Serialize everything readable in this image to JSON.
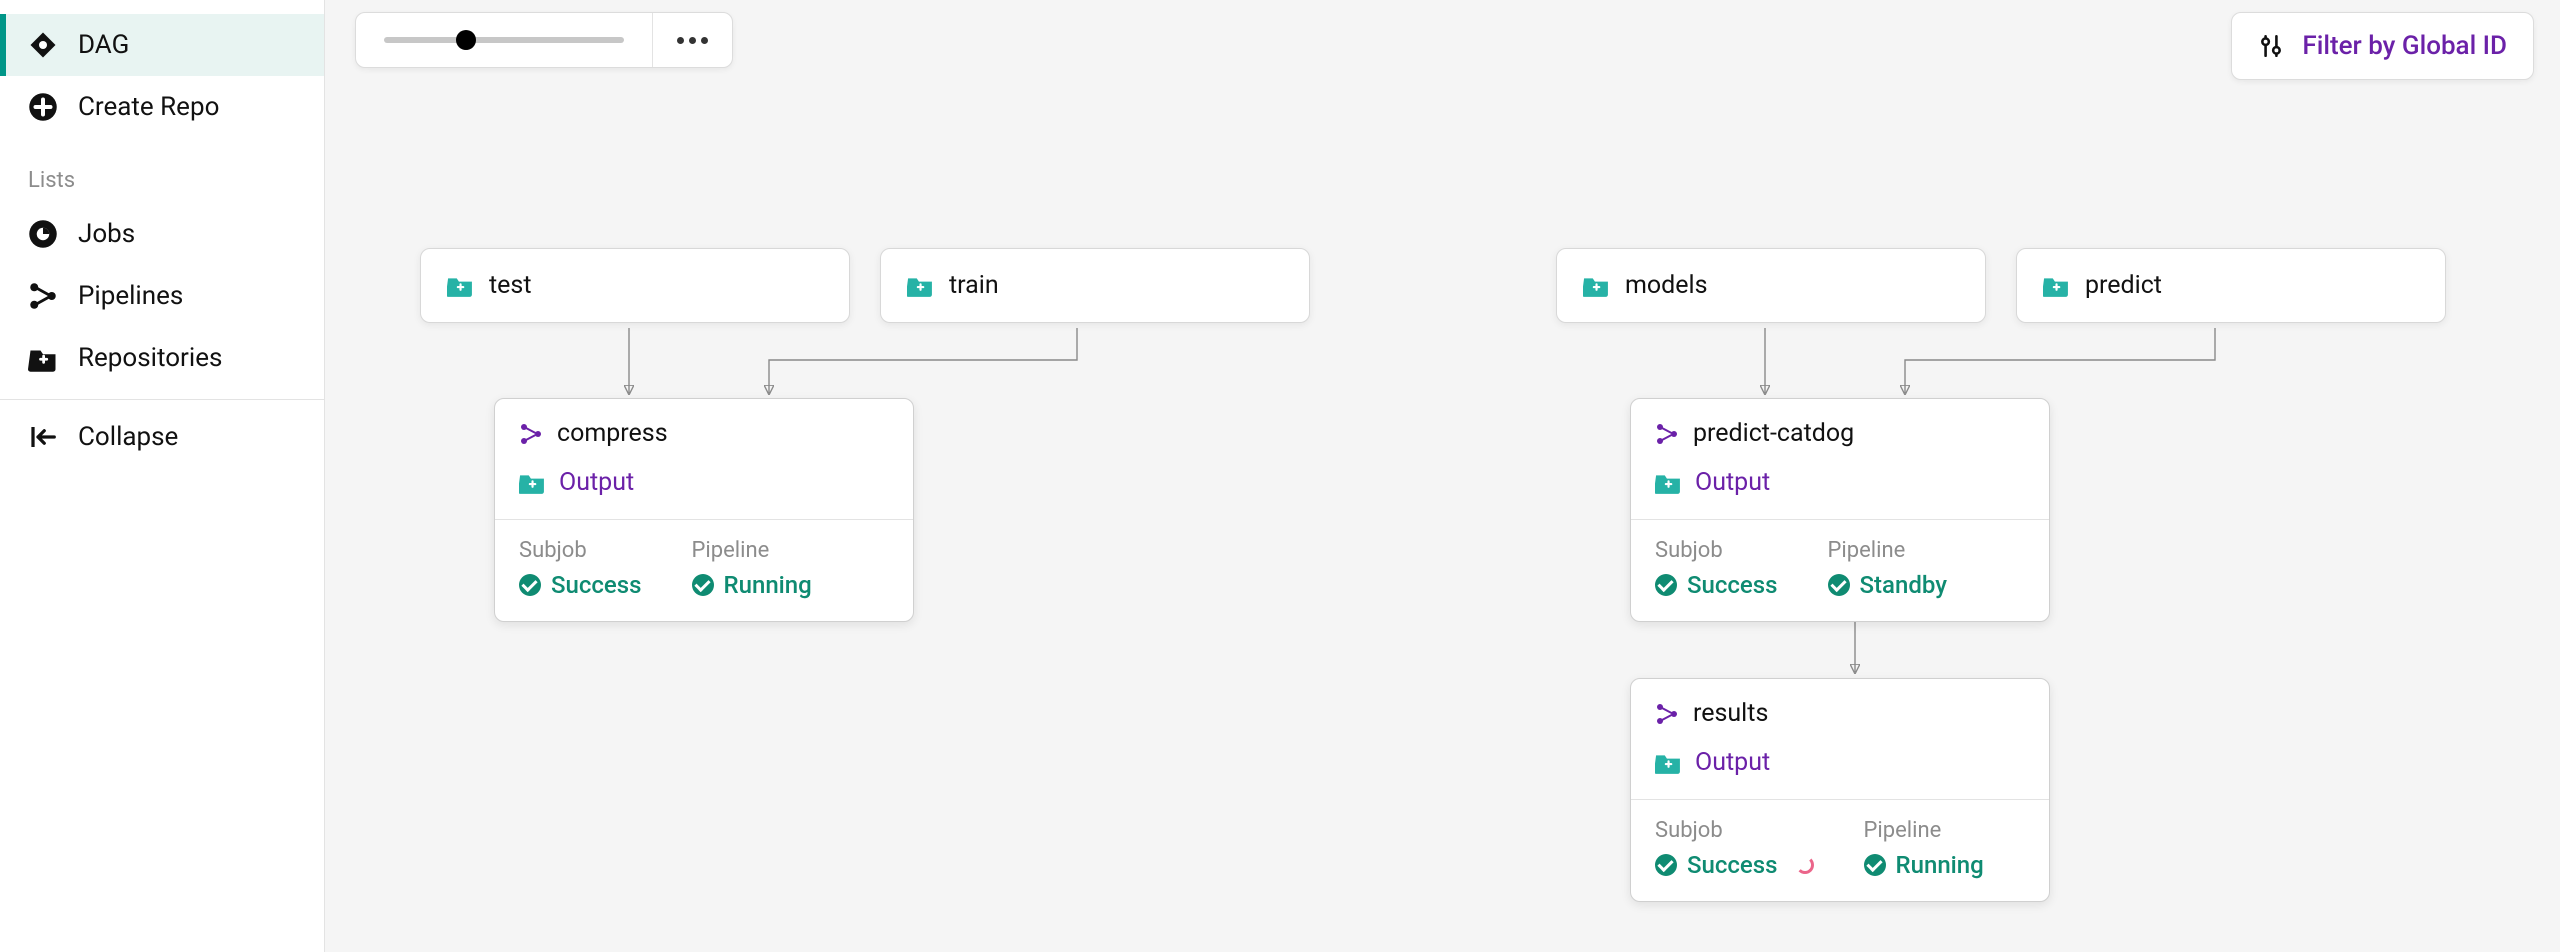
{
  "sidebar": {
    "dag": "DAG",
    "create_repo": "Create Repo",
    "lists_label": "Lists",
    "jobs": "Jobs",
    "pipelines": "Pipelines",
    "repositories": "Repositories",
    "collapse": "Collapse"
  },
  "toolbar": {
    "filter_label": "Filter by Global ID"
  },
  "repos": {
    "test": "test",
    "train": "train",
    "models": "models",
    "predict": "predict"
  },
  "pipelines": {
    "compress": {
      "name": "compress",
      "output_label": "Output",
      "subjob_label": "Subjob",
      "pipeline_label": "Pipeline",
      "subjob_status": "Success",
      "pipeline_status": "Running"
    },
    "predict_catdog": {
      "name": "predict-catdog",
      "output_label": "Output",
      "subjob_label": "Subjob",
      "pipeline_label": "Pipeline",
      "subjob_status": "Success",
      "pipeline_status": "Standby"
    },
    "results": {
      "name": "results",
      "output_label": "Output",
      "subjob_label": "Subjob",
      "pipeline_label": "Pipeline",
      "subjob_status": "Success",
      "pipeline_status": "Running"
    }
  }
}
